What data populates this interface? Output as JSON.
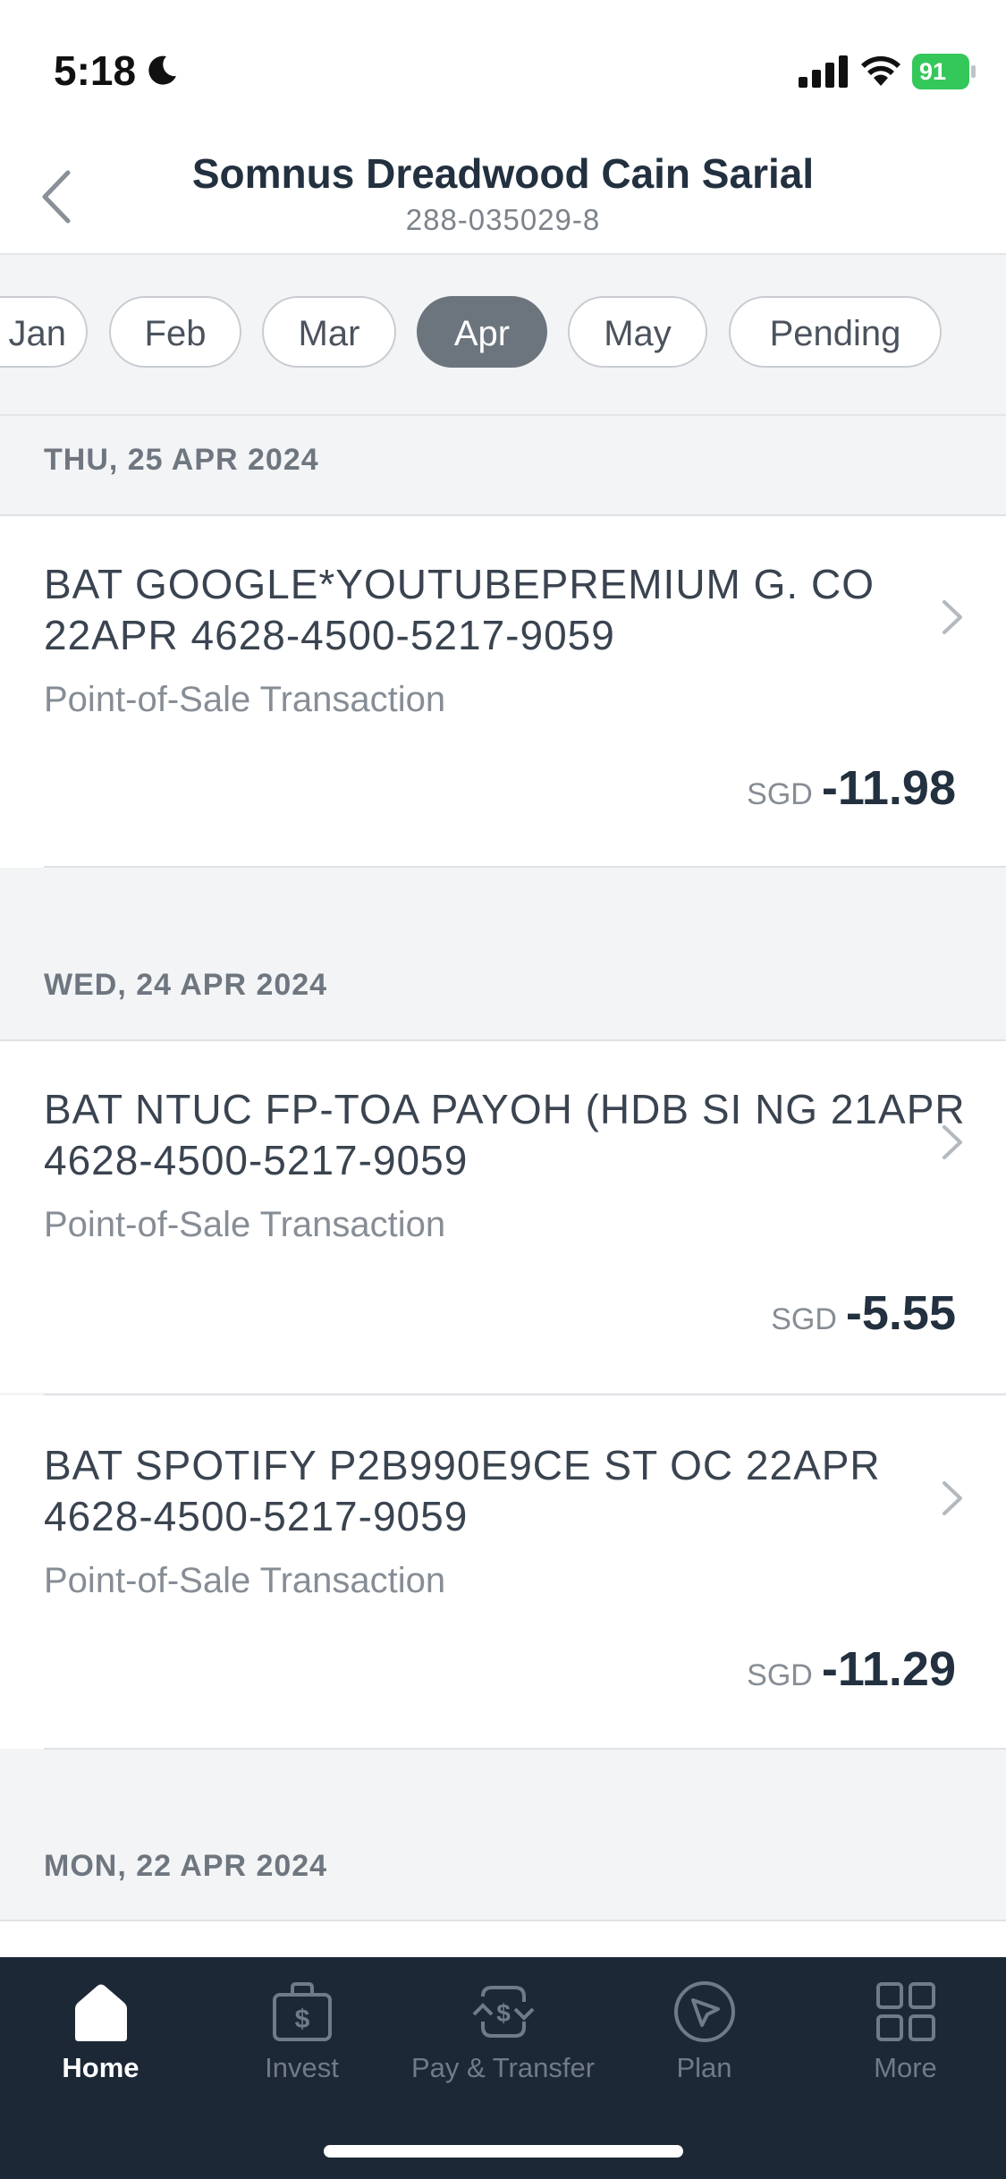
{
  "status_bar": {
    "time": "5:18",
    "battery": "91"
  },
  "header": {
    "title": "Somnus Dreadwood Cain Sarial",
    "subtitle": "288-035029-8"
  },
  "months": [
    {
      "label": "Jan"
    },
    {
      "label": "Feb"
    },
    {
      "label": "Mar"
    },
    {
      "label": "Apr",
      "selected": true
    },
    {
      "label": "May"
    },
    {
      "label": "Pending"
    }
  ],
  "sections": [
    {
      "date": "THU, 25 APR 2024",
      "transactions": [
        {
          "title": "BAT GOOGLE*YOUTUBEPREMIUM G. CO 22APR 4628-4500-5217-9059",
          "type": "Point-of-Sale Transaction",
          "currency": "SGD",
          "amount": "-11.98"
        }
      ]
    },
    {
      "date": "WED, 24 APR 2024",
      "transactions": [
        {
          "title": "BAT NTUC FP-TOA PAYOH (HDB SI NG 21APR 4628-4500-5217-9059",
          "type": "Point-of-Sale Transaction",
          "currency": "SGD",
          "amount": "-5.55"
        },
        {
          "title": "BAT SPOTIFY P2B990E9CE ST OC 22APR 4628-4500-5217-9059",
          "type": "Point-of-Sale Transaction",
          "currency": "SGD",
          "amount": "-11.29"
        }
      ]
    },
    {
      "date": "MON, 22 APR 2024",
      "transactions": []
    }
  ],
  "tabbar": {
    "items": [
      {
        "label": "Home",
        "icon": "home-icon",
        "active": true
      },
      {
        "label": "Invest",
        "icon": "briefcase-dollar-icon"
      },
      {
        "label": "Pay & Transfer",
        "icon": "pay-transfer-icon"
      },
      {
        "label": "Plan",
        "icon": "compass-icon"
      },
      {
        "label": "More",
        "icon": "grid-icon"
      }
    ]
  },
  "colors": {
    "active_chip": "#6c757e",
    "tabbar_bg": "#1d2837",
    "battery": "#34c759"
  }
}
